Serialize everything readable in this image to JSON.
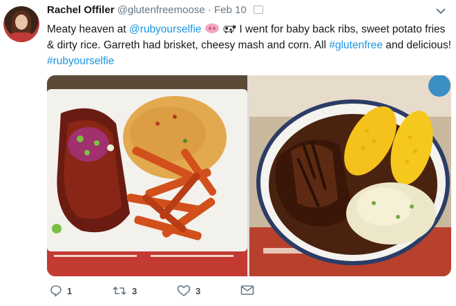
{
  "tweet": {
    "display_name": "Rachel Offiler",
    "handle": "@glutenfreemoose",
    "separator": "·",
    "date": "Feb 10",
    "text_1": "Meaty heaven at ",
    "mention": "@rubyourselfie",
    "text_2": " I went for baby back ribs, sweet potato fries & dirty rice. Garreth had brisket, cheesy mash and corn. All ",
    "hashtag_1": "#glutenfree",
    "text_3": " and delicious! ",
    "hashtag_2": "#rubyourselfie",
    "emojis": [
      "pig-nose-emoji",
      "cow-emoji"
    ]
  },
  "media": {
    "photo_1": "ribs-sweet-potato-fries-rice-photo",
    "photo_2": "brisket-corn-cheesy-mash-photo"
  },
  "actions": {
    "reply_count": "1",
    "retweet_count": "3",
    "like_count": "3"
  },
  "colors": {
    "link": "#1b95e0",
    "text": "#14171a",
    "secondary": "#657786"
  }
}
